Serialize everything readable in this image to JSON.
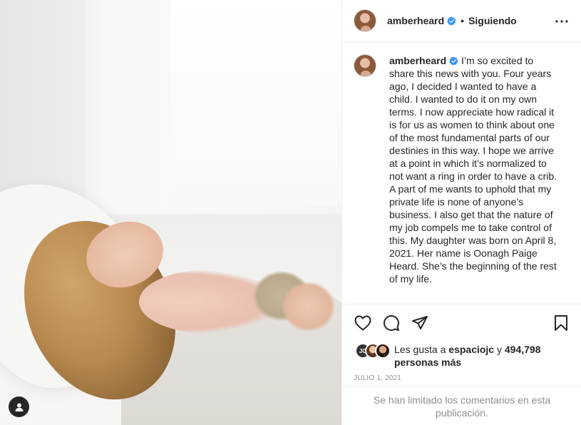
{
  "post": {
    "author": "amberheard",
    "follow_status": "Siguiendo",
    "separator": "•",
    "caption": "I’m so excited to share this news with you. Four years ago, I decided I wanted to have a child. I wanted to do it on my own terms. I now appreciate how radical it is for us as women to think about one of the most fundamental parts of our destinies in this way. I hope we arrive at a point in which it’s normalized to not want a ring in order to have a crib. A part of me wants to uphold that my private life is none of anyone’s business. I also get that the nature of my job compels me to take control of this. My daughter was born on April 8, 2021. Her name is Oonagh Paige Heard. She’s the beginning of the rest of my life.",
    "likes": {
      "prefix": "Les gusta a",
      "first_liker": "espaciojc",
      "conjunction": "y",
      "others": "494,798 personas más",
      "first_liker_initials": "JC"
    },
    "date": "JULIO 1, 2021",
    "comments_notice": "Se han limitado los comentarios en esta publicación."
  },
  "icons": {
    "verified": "verified-badge-icon",
    "more": "more-options-icon",
    "like": "heart-icon",
    "comment": "comment-icon",
    "share": "send-icon",
    "save": "bookmark-icon",
    "user_tag": "user-tag-icon"
  },
  "colors": {
    "verified": "#3897f0",
    "text": "#262626",
    "muted": "#8e8e8e",
    "border": "#efefef"
  }
}
